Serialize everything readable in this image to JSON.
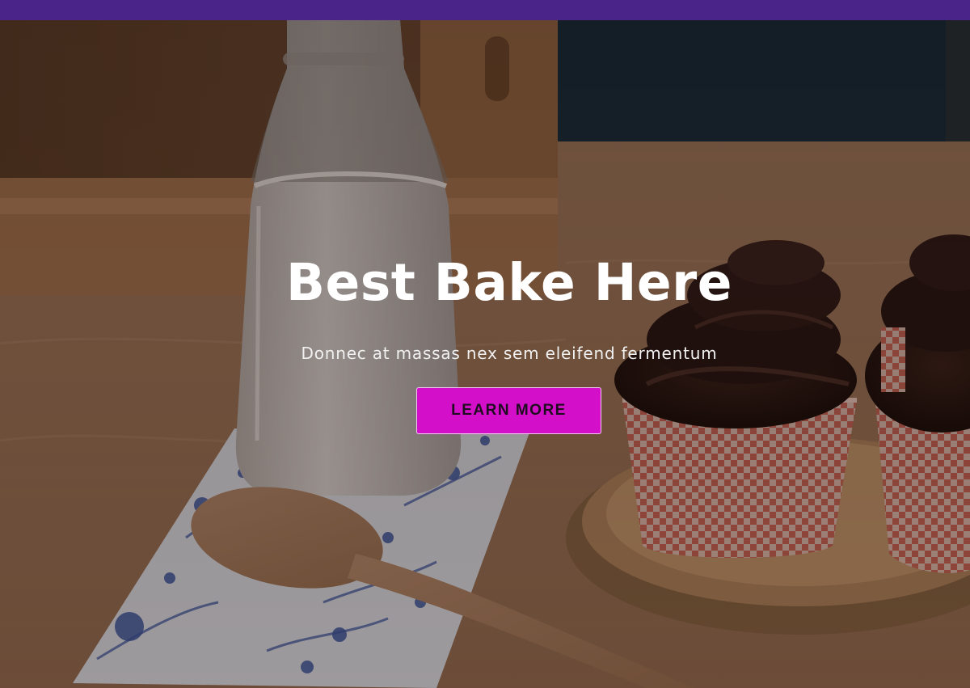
{
  "hero": {
    "title": "Best Bake Here",
    "subtitle": "Donnec at massas nex sem eleifend fermentum",
    "cta_label": "LEARN MORE",
    "background_description_icon": "bakery-photo-image"
  },
  "colors": {
    "topbar": "#4b2489",
    "cta_background": "#d30fca",
    "title_text": "#ffffff"
  }
}
